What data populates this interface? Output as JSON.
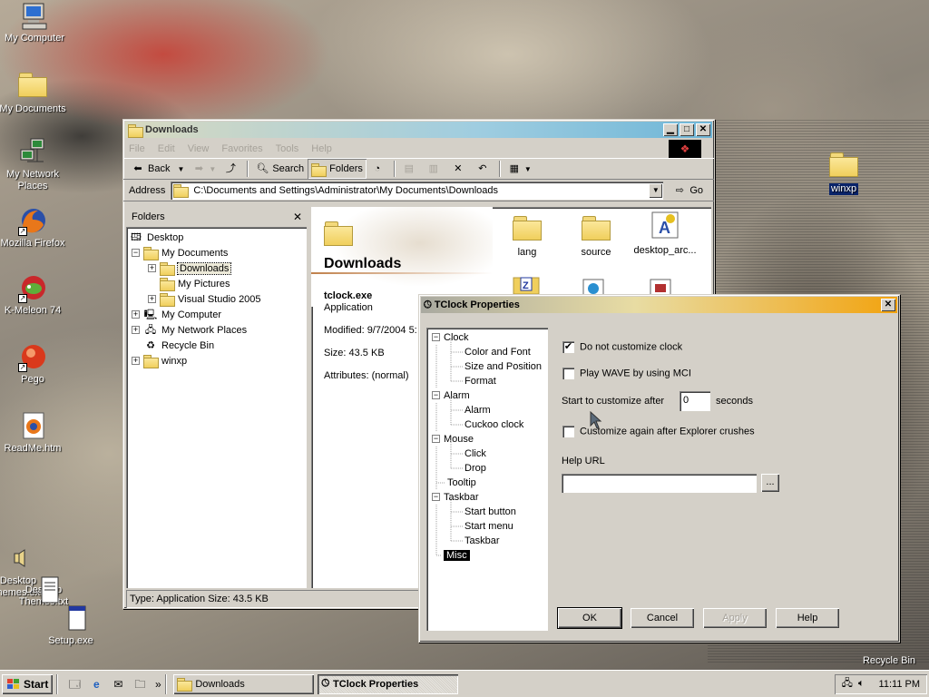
{
  "desktop": {
    "icons": [
      {
        "label": "My Computer"
      },
      {
        "label": "My Documents"
      },
      {
        "label": "My Network Places"
      },
      {
        "label": "Mozilla Firefox"
      },
      {
        "label": "K-Meleon 74"
      },
      {
        "label": "Pego"
      },
      {
        "label": "ReadMe.htm"
      },
      {
        "label": "Desktop Themes.exe"
      },
      {
        "label": "Desktop Themes.txt"
      },
      {
        "label": "Setup.exe"
      },
      {
        "label": "winxp"
      },
      {
        "label": "Recycle Bin"
      }
    ]
  },
  "explorer": {
    "title": "Downloads",
    "menu": [
      "File",
      "Edit",
      "View",
      "Favorites",
      "Tools",
      "Help"
    ],
    "toolbar": {
      "back": "Back",
      "search": "Search",
      "folders": "Folders"
    },
    "address": {
      "label": "Address",
      "value": "C:\\Documents and Settings\\Administrator\\My Documents\\Downloads",
      "go": "Go"
    },
    "folders_panel": {
      "title": "Folders",
      "tree": [
        "Desktop",
        "My Documents",
        "Downloads",
        "My Pictures",
        "Visual Studio 2005",
        "My Computer",
        "My Network Places",
        "Recycle Bin",
        "winxp"
      ]
    },
    "content": {
      "heading": "Downloads",
      "file_name": "tclock.exe",
      "file_type": "Application",
      "modified": "Modified: 9/7/2004 5:",
      "size": "Size: 43.5 KB",
      "attributes": "Attributes: (normal)",
      "items": [
        "lang",
        "source",
        "desktop_arc..."
      ]
    },
    "status": "Type: Application Size: 43.5 KB"
  },
  "dialog": {
    "title": "TClock Properties",
    "tree": {
      "clock": "Clock",
      "color_font": "Color and Font",
      "size_position": "Size and Position",
      "format": "Format",
      "alarm_group": "Alarm",
      "alarm": "Alarm",
      "cuckoo": "Cuckoo clock",
      "mouse": "Mouse",
      "click": "Click",
      "drop": "Drop",
      "tooltip": "Tooltip",
      "taskbar": "Taskbar",
      "start_button": "Start button",
      "start_menu": "Start menu",
      "taskbar_item": "Taskbar",
      "misc": "Misc"
    },
    "options": {
      "no_customize": "Do not customize clock",
      "no_customize_checked": true,
      "play_wave": "Play WAVE by using MCI",
      "start_after": "Start to customize after",
      "start_after_value": "0",
      "seconds": "seconds",
      "customize_again": "Customize again after Explorer crushes",
      "help_url": "Help URL",
      "help_url_value": "",
      "browse": "..."
    },
    "buttons": {
      "ok": "OK",
      "cancel": "Cancel",
      "apply": "Apply",
      "help": "Help"
    }
  },
  "taskbar": {
    "start": "Start",
    "tasks": [
      "Downloads",
      "TClock Properties"
    ],
    "clock": "11:11 PM"
  }
}
